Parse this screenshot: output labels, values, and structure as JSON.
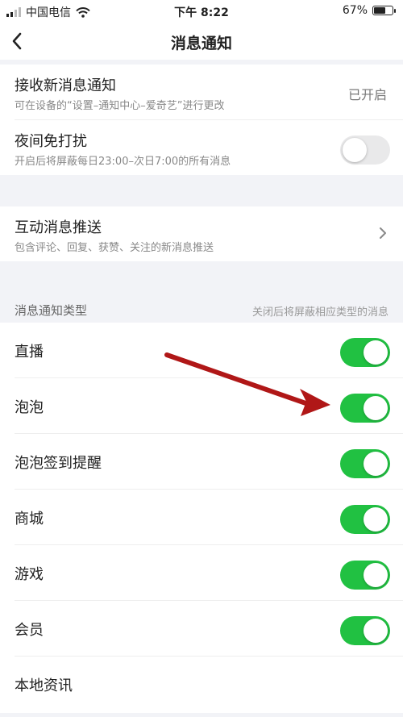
{
  "status_bar": {
    "carrier": "中国电信",
    "time": "下午 8:22",
    "battery_text": "67%",
    "battery_level": 0.67,
    "wifi_icon": "wifi-icon"
  },
  "nav": {
    "back_icon": "chevron-left-icon",
    "title": "消息通知"
  },
  "receive": {
    "title": "接收新消息通知",
    "subtitle": "可在设备的“设置–通知中心–爱奇艺”进行更改",
    "value": "已开启"
  },
  "night": {
    "title": "夜间免打扰",
    "subtitle": "开启后将屏蔽每日23:00–次日7:00的所有消息",
    "enabled": false
  },
  "interaction": {
    "title": "互动消息推送",
    "subtitle": "包含评论、回复、获赞、关注的新消息推送"
  },
  "types": {
    "header": "消息通知类型",
    "hint": "关闭后将屏蔽相应类型的消息",
    "items": [
      {
        "label": "直播",
        "enabled": true
      },
      {
        "label": "泡泡",
        "enabled": true
      },
      {
        "label": "泡泡签到提醒",
        "enabled": true
      },
      {
        "label": "商城",
        "enabled": true
      },
      {
        "label": "游戏",
        "enabled": true
      },
      {
        "label": "会员",
        "enabled": true
      },
      {
        "label": "本地资讯"
      }
    ]
  },
  "colors": {
    "toggle_on": "#21c142",
    "toggle_off": "#e9e9ea",
    "annotation_arrow": "#b01717"
  }
}
